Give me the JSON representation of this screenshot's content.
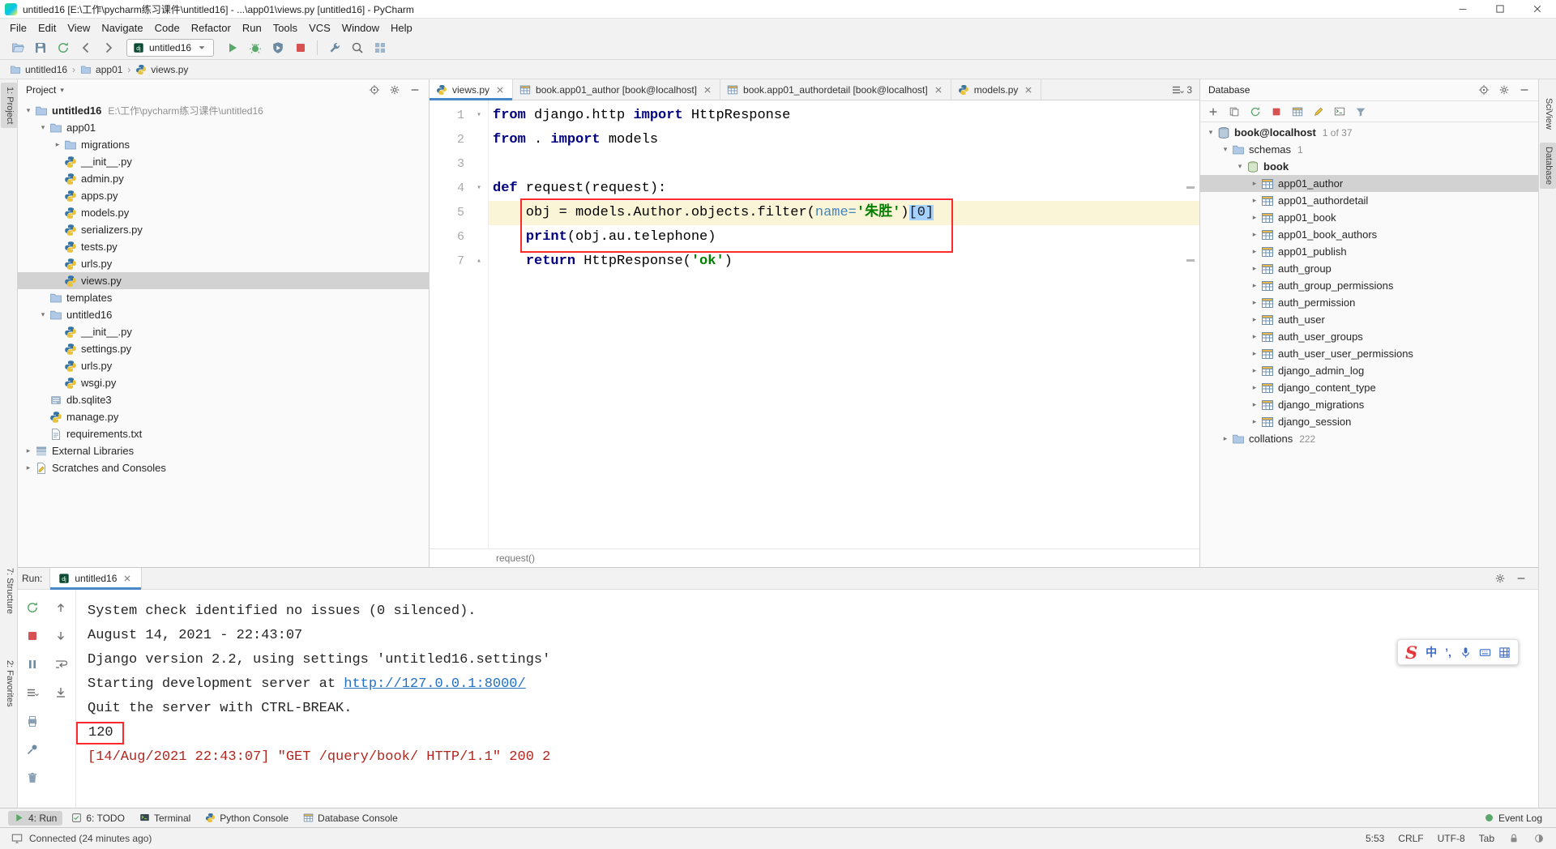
{
  "colors": {
    "keyword": "#000080",
    "string": "#008000",
    "parameter": "#4584B9",
    "selection": "#A6D2FF",
    "current_line": "#FBF5D7",
    "link": "#2470C3",
    "stderr": "#B3261E",
    "annotation": "#FF2B2B",
    "tab_underline": "#4A88C7",
    "run_green": "#59A869",
    "stop_red": "#D65252"
  },
  "titlebar": {
    "title": "untitled16 [E:\\工作\\pycharm练习课件\\untitled16] - ...\\app01\\views.py [untitled16] - PyCharm"
  },
  "menu": [
    "File",
    "Edit",
    "View",
    "Navigate",
    "Code",
    "Refactor",
    "Run",
    "Tools",
    "VCS",
    "Window",
    "Help"
  ],
  "toolbar": {
    "group1": [
      "folder-open",
      "save",
      "sync",
      "back",
      "forward"
    ],
    "run_config": {
      "icon": "django",
      "label": "untitled16"
    },
    "group2": [
      "run",
      "debug",
      "coverage",
      "stop"
    ],
    "group3": [
      "wrench",
      "search",
      "layout"
    ]
  },
  "breadcrumb_separator": "›",
  "breadcrumbs": [
    {
      "icon": "folder",
      "label": "untitled16"
    },
    {
      "icon": "folder",
      "label": "app01"
    },
    {
      "icon": "python",
      "label": "views.py"
    }
  ],
  "stripes": {
    "left": [
      {
        "label": "1: Project",
        "active": true
      },
      {
        "label": "7: Structure",
        "active": false
      },
      {
        "label": "2: Favorites",
        "active": false
      }
    ],
    "right": [
      {
        "label": "SciView",
        "active": false
      },
      {
        "label": "Database",
        "active": true
      }
    ]
  },
  "project": {
    "header": "Project",
    "header_icons": [
      "target",
      "gear",
      "minus"
    ],
    "tree": [
      {
        "level": 0,
        "chevron": "down",
        "icon": "folder",
        "label": "untitled16",
        "extra": "E:\\工作\\pycharm练习课件\\untitled16",
        "bold": true
      },
      {
        "level": 1,
        "chevron": "down",
        "icon": "folder",
        "label": "app01"
      },
      {
        "level": 2,
        "chevron": "right",
        "icon": "folder",
        "label": "migrations"
      },
      {
        "level": 2,
        "chevron": "none",
        "icon": "python",
        "label": "__init__.py"
      },
      {
        "level": 2,
        "chevron": "none",
        "icon": "python",
        "label": "admin.py"
      },
      {
        "level": 2,
        "chevron": "none",
        "icon": "python",
        "label": "apps.py"
      },
      {
        "level": 2,
        "chevron": "none",
        "icon": "python",
        "label": "models.py"
      },
      {
        "level": 2,
        "chevron": "none",
        "icon": "python",
        "label": "serializers.py"
      },
      {
        "level": 2,
        "chevron": "none",
        "icon": "python",
        "label": "tests.py"
      },
      {
        "level": 2,
        "chevron": "none",
        "icon": "python",
        "label": "urls.py"
      },
      {
        "level": 2,
        "chevron": "none",
        "icon": "python",
        "label": "views.py",
        "selected": true
      },
      {
        "level": 1,
        "chevron": "none",
        "icon": "folder",
        "label": "templates"
      },
      {
        "level": 1,
        "chevron": "down",
        "icon": "folder",
        "label": "untitled16"
      },
      {
        "level": 2,
        "chevron": "none",
        "icon": "python",
        "label": "__init__.py"
      },
      {
        "level": 2,
        "chevron": "none",
        "icon": "python",
        "label": "settings.py"
      },
      {
        "level": 2,
        "chevron": "none",
        "icon": "python",
        "label": "urls.py"
      },
      {
        "level": 2,
        "chevron": "none",
        "icon": "python",
        "label": "wsgi.py"
      },
      {
        "level": 1,
        "chevron": "none",
        "icon": "sqlite",
        "label": "db.sqlite3"
      },
      {
        "level": 1,
        "chevron": "none",
        "icon": "python",
        "label": "manage.py"
      },
      {
        "level": 1,
        "chevron": "none",
        "icon": "text",
        "label": "requirements.txt"
      },
      {
        "level": 0,
        "chevron": "right",
        "icon": "libs",
        "label": "External Libraries"
      },
      {
        "level": 0,
        "chevron": "right",
        "icon": "scratch",
        "label": "Scratches and Consoles"
      }
    ]
  },
  "editor": {
    "tabs": [
      {
        "icon": "python",
        "label": "views.py",
        "active": true
      },
      {
        "icon": "table",
        "label": "book.app01_author [book@localhost]",
        "active": false
      },
      {
        "icon": "table",
        "label": "book.app01_authordetail [book@localhost]",
        "active": false
      },
      {
        "icon": "python",
        "label": "models.py",
        "active": false
      }
    ],
    "hidden_tabs": "3",
    "lines": [
      {
        "num": "1",
        "fold": "down",
        "segments": [
          {
            "t": "from",
            "s": "kw"
          },
          {
            "t": " django.http ",
            "s": "pl"
          },
          {
            "t": "import",
            "s": "kw"
          },
          {
            "t": " HttpResponse",
            "s": "pl"
          }
        ]
      },
      {
        "num": "2",
        "fold": "none",
        "segments": [
          {
            "t": "from",
            "s": "kw"
          },
          {
            "t": " . ",
            "s": "pl"
          },
          {
            "t": "import",
            "s": "kw"
          },
          {
            "t": " models",
            "s": "pl"
          }
        ]
      },
      {
        "num": "3",
        "fold": "none",
        "segments": []
      },
      {
        "num": "4",
        "fold": "down",
        "segments": [
          {
            "t": "def",
            "s": "kw"
          },
          {
            "t": " request(request):",
            "s": "pl"
          }
        ]
      },
      {
        "num": "5",
        "fold": "none",
        "current": true,
        "segments": [
          {
            "t": "    obj = models.Author.objects.filter(",
            "s": "pl"
          },
          {
            "t": "name=",
            "s": "param"
          },
          {
            "t": "'朱胜'",
            "s": "str"
          },
          {
            "t": ")",
            "s": "pl"
          },
          {
            "t": "[0]",
            "s": "sel"
          }
        ]
      },
      {
        "num": "6",
        "fold": "none",
        "segments": [
          {
            "t": "    ",
            "s": "pl"
          },
          {
            "t": "print",
            "s": "kw"
          },
          {
            "t": "(obj.au.telephone)",
            "s": "pl"
          }
        ]
      },
      {
        "num": "7",
        "fold": "up",
        "segments": [
          {
            "t": "    ",
            "s": "pl"
          },
          {
            "t": "return",
            "s": "kw"
          },
          {
            "t": " HttpResponse(",
            "s": "pl"
          },
          {
            "t": "'ok'",
            "s": "str"
          },
          {
            "t": ")",
            "s": "pl"
          }
        ]
      }
    ],
    "footer_breadcrumb": "request()"
  },
  "database": {
    "title": "Database",
    "header_icons": [
      "target",
      "gear",
      "minus"
    ],
    "toolbar_icons": [
      "plus",
      "copy",
      "sync",
      "stop",
      "table",
      "pencil",
      "console",
      "funnel"
    ],
    "tree": [
      {
        "level": 0,
        "chevron": "down",
        "icon": "db",
        "label": "book@localhost",
        "extra": "1 of 37",
        "bold": true
      },
      {
        "level": 1,
        "chevron": "down",
        "icon": "folder",
        "label": "schemas",
        "extra": "1"
      },
      {
        "level": 2,
        "chevron": "down",
        "icon": "schema",
        "label": "book",
        "bold": true
      },
      {
        "level": 3,
        "chevron": "right",
        "icon": "table",
        "label": "app01_author",
        "selected": true
      },
      {
        "level": 3,
        "chevron": "right",
        "icon": "table",
        "label": "app01_authordetail"
      },
      {
        "level": 3,
        "chevron": "right",
        "icon": "table",
        "label": "app01_book"
      },
      {
        "level": 3,
        "chevron": "right",
        "icon": "table",
        "label": "app01_book_authors"
      },
      {
        "level": 3,
        "chevron": "right",
        "icon": "table",
        "label": "app01_publish"
      },
      {
        "level": 3,
        "chevron": "right",
        "icon": "table",
        "label": "auth_group"
      },
      {
        "level": 3,
        "chevron": "right",
        "icon": "table",
        "label": "auth_group_permissions"
      },
      {
        "level": 3,
        "chevron": "right",
        "icon": "table",
        "label": "auth_permission"
      },
      {
        "level": 3,
        "chevron": "right",
        "icon": "table",
        "label": "auth_user"
      },
      {
        "level": 3,
        "chevron": "right",
        "icon": "table",
        "label": "auth_user_groups"
      },
      {
        "level": 3,
        "chevron": "right",
        "icon": "table",
        "label": "auth_user_user_permissions"
      },
      {
        "level": 3,
        "chevron": "right",
        "icon": "table",
        "label": "django_admin_log"
      },
      {
        "level": 3,
        "chevron": "right",
        "icon": "table",
        "label": "django_content_type"
      },
      {
        "level": 3,
        "chevron": "right",
        "icon": "table",
        "label": "django_migrations"
      },
      {
        "level": 3,
        "chevron": "right",
        "icon": "table",
        "label": "django_session"
      },
      {
        "level": 1,
        "chevron": "right",
        "icon": "folder",
        "label": "collations",
        "extra": "222"
      }
    ]
  },
  "run": {
    "label": "Run:",
    "tab": {
      "icon": "django",
      "label": "untitled16"
    },
    "tabbar_icons": [
      "gear",
      "minus"
    ],
    "toolbar_icons": [
      {
        "icon": "sync",
        "name": "rerun"
      },
      {
        "icon": "up",
        "name": "up-stack-trace"
      },
      {
        "icon": "stop",
        "name": "stop"
      },
      {
        "icon": "down",
        "name": "down-stack-trace"
      },
      {
        "icon": "pause",
        "name": "pause-output"
      },
      {
        "icon": "softwrap",
        "name": "soft-wrap"
      },
      {
        "icon": "list3",
        "name": "show-console-list"
      },
      {
        "icon": "scrollend",
        "name": "scroll-to-end"
      },
      {
        "icon": "print",
        "name": "print"
      },
      null,
      {
        "icon": "pin",
        "name": "pin-tab"
      },
      null,
      {
        "icon": "trash",
        "name": "clear-all"
      },
      null
    ],
    "console": [
      {
        "segments": [
          {
            "t": "System check identified no issues (0 silenced).",
            "s": "pl"
          }
        ]
      },
      {
        "segments": [
          {
            "t": "August 14, 2021 - 22:43:07",
            "s": "pl"
          }
        ]
      },
      {
        "segments": [
          {
            "t": "Django version 2.2, using settings 'untitled16.settings'",
            "s": "pl"
          }
        ]
      },
      {
        "segments": [
          {
            "t": "Starting development server at ",
            "s": "pl"
          },
          {
            "t": "http://127.0.0.1:8000/",
            "s": "link"
          }
        ]
      },
      {
        "segments": [
          {
            "t": "Quit the server with CTRL-BREAK.",
            "s": "pl"
          }
        ]
      },
      {
        "boxed": true,
        "segments": [
          {
            "t": "120",
            "s": "pl"
          }
        ]
      },
      {
        "segments": [
          {
            "t": "[14/Aug/2021 22:43:07] \"GET /query/book/ HTTP/1.1\" 200 2",
            "s": "err"
          }
        ]
      }
    ]
  },
  "bottom_bar": {
    "left": [
      {
        "icon": "run",
        "label": "4: Run",
        "active": true
      },
      {
        "icon": "todo",
        "label": "6: TODO",
        "active": false
      },
      {
        "icon": "terminal",
        "label": "Terminal",
        "active": false
      },
      {
        "icon": "python",
        "label": "Python Console",
        "active": false
      },
      {
        "icon": "table",
        "label": "Database Console",
        "active": false
      }
    ],
    "right": [
      {
        "icon": "event",
        "label": "Event Log",
        "active": false
      }
    ]
  },
  "status_bar": {
    "left": "Connected (24 minutes ago)",
    "right_items": [
      "5:53",
      "CRLF",
      "UTF-8",
      "Tab"
    ],
    "right_icons": [
      "lock",
      "hector"
    ]
  },
  "sogou": {
    "logo": "S",
    "mode_label": "中",
    "punct_label": "’,",
    "icons": [
      "mic",
      "keyboard",
      "grid9"
    ]
  }
}
